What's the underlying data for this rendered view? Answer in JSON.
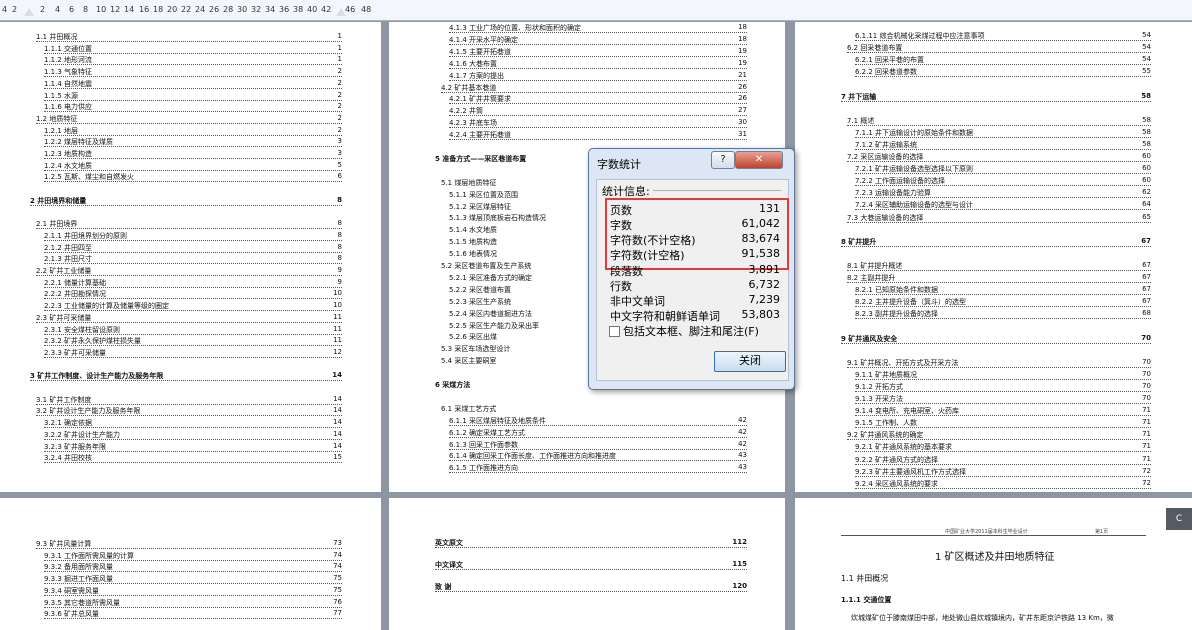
{
  "ruler": {
    "ticks": [
      "4",
      "2",
      "2",
      "4",
      "6",
      "8",
      "10",
      "12",
      "14",
      "16",
      "18",
      "20",
      "22",
      "24",
      "26",
      "28",
      "30",
      "32",
      "34",
      "36",
      "38",
      "40",
      "42",
      "46",
      "48"
    ]
  },
  "pages": {
    "p1": [
      {
        "t": "1.1  井田概况",
        "p": "1",
        "lvl": 1
      },
      {
        "t": "1.1.1  交通位置",
        "p": "1",
        "lvl": 2
      },
      {
        "t": "1.1.2  地形河流",
        "p": "1",
        "lvl": 2
      },
      {
        "t": "1.1.3  气象特征",
        "p": "2",
        "lvl": 2
      },
      {
        "t": "1.1.4  自然地震",
        "p": "2",
        "lvl": 2
      },
      {
        "t": "1.1.5  水源",
        "p": "2",
        "lvl": 2
      },
      {
        "t": "1.1.6  电力供应",
        "p": "2",
        "lvl": 2
      },
      {
        "t": "1.2  地质特征",
        "p": "2",
        "lvl": 1
      },
      {
        "t": "1.2.1  地层",
        "p": "2",
        "lvl": 2
      },
      {
        "t": "1.2.2  煤层特征及煤质",
        "p": "3",
        "lvl": 2
      },
      {
        "t": "1.2.3  地质构造",
        "p": "3",
        "lvl": 2
      },
      {
        "t": "1.2.4  水文地质",
        "p": "5",
        "lvl": 2
      },
      {
        "t": "1.2.5  瓦斯、煤尘和自燃发火",
        "p": "6",
        "lvl": 2
      },
      {
        "t": "",
        "p": "",
        "lvl": 0
      },
      {
        "t": "2  井田境界和储量",
        "p": "8",
        "lvl": 0
      },
      {
        "t": "",
        "p": "",
        "lvl": 0
      },
      {
        "t": "2.1  井田境界",
        "p": "8",
        "lvl": 1
      },
      {
        "t": "2.1.1  井田境界划分的原则",
        "p": "8",
        "lvl": 2
      },
      {
        "t": "2.1.2  井田四至",
        "p": "8",
        "lvl": 2
      },
      {
        "t": "2.1.3  井田尺寸",
        "p": "8",
        "lvl": 2
      },
      {
        "t": "2.2  矿井工业储量",
        "p": "9",
        "lvl": 1
      },
      {
        "t": "2.2.1  储量计算基础",
        "p": "9",
        "lvl": 2
      },
      {
        "t": "2.2.2  井田勘探情况",
        "p": "10",
        "lvl": 2
      },
      {
        "t": "2.2.3  工业储量的计算及储量等级的圈定",
        "p": "10",
        "lvl": 2
      },
      {
        "t": "2.3  矿井可采储量",
        "p": "11",
        "lvl": 1
      },
      {
        "t": "2.3.1  安全煤柱留设原则",
        "p": "11",
        "lvl": 2
      },
      {
        "t": "2.3.2  矿井永久保护煤柱损失量",
        "p": "11",
        "lvl": 2
      },
      {
        "t": "2.3.3  矿井可采储量",
        "p": "12",
        "lvl": 2
      },
      {
        "t": "",
        "p": "",
        "lvl": 0
      },
      {
        "t": "3  矿井工作制度、设计生产能力及服务年限",
        "p": "14",
        "lvl": 0
      },
      {
        "t": "",
        "p": "",
        "lvl": 0
      },
      {
        "t": "3.1  矿井工作制度",
        "p": "14",
        "lvl": 1
      },
      {
        "t": "3.2  矿井设计生产能力及服务年限",
        "p": "14",
        "lvl": 1
      },
      {
        "t": "3.2.1  确定依据",
        "p": "14",
        "lvl": 2
      },
      {
        "t": "3.2.2  矿井设计生产能力",
        "p": "14",
        "lvl": 2
      },
      {
        "t": "3.2.3  矿井服务年限",
        "p": "14",
        "lvl": 2
      },
      {
        "t": "3.2.4  井田校核",
        "p": "15",
        "lvl": 2
      }
    ],
    "p2": [
      {
        "t": "4.1.3  工业广场的位置、形状和面积的确定",
        "p": "18",
        "lvl": 2
      },
      {
        "t": "4.1.4  开采水平的确定",
        "p": "18",
        "lvl": 2
      },
      {
        "t": "4.1.5  主要开拓巷道",
        "p": "19",
        "lvl": 2
      },
      {
        "t": "4.1.6  大巷布置",
        "p": "19",
        "lvl": 2
      },
      {
        "t": "4.1.7  方案的提出",
        "p": "21",
        "lvl": 2
      },
      {
        "t": "4.2  矿井基本巷道",
        "p": "26",
        "lvl": 1
      },
      {
        "t": "4.2.1  矿井井筒要求",
        "p": "26",
        "lvl": 2
      },
      {
        "t": "4.2.2  井筒",
        "p": "27",
        "lvl": 2
      },
      {
        "t": "4.2.3  井底车场",
        "p": "30",
        "lvl": 2
      },
      {
        "t": "4.2.4  主要开拓巷道",
        "p": "31",
        "lvl": 2
      },
      {
        "t": "",
        "p": "",
        "lvl": 0
      },
      {
        "t": "5  准备方式——采区巷道布置",
        "p": "",
        "lvl": 0
      },
      {
        "t": "",
        "p": "",
        "lvl": 0
      },
      {
        "t": "5.1  煤层地质特征",
        "p": "",
        "lvl": 1
      },
      {
        "t": "5.1.1  采区位置及范围",
        "p": "",
        "lvl": 2
      },
      {
        "t": "5.1.2  采区煤层特征",
        "p": "",
        "lvl": 2
      },
      {
        "t": "5.1.3  煤层顶底板岩石构造情况",
        "p": "",
        "lvl": 2
      },
      {
        "t": "5.1.4  水文地质",
        "p": "",
        "lvl": 2
      },
      {
        "t": "5.1.5  地质构造",
        "p": "",
        "lvl": 2
      },
      {
        "t": "5.1.6  地表情况",
        "p": "",
        "lvl": 2
      },
      {
        "t": "5.2  采区巷道布置及生产系统",
        "p": "",
        "lvl": 1
      },
      {
        "t": "5.2.1  采区准备方式的确定",
        "p": "",
        "lvl": 2
      },
      {
        "t": "5.2.2  采区巷道布置",
        "p": "",
        "lvl": 2
      },
      {
        "t": "5.2.3  采区生产系统",
        "p": "",
        "lvl": 2
      },
      {
        "t": "5.2.4  采区内巷道掘进方法",
        "p": "",
        "lvl": 2
      },
      {
        "t": "5.2.5  采区生产能力及采出率",
        "p": "",
        "lvl": 2
      },
      {
        "t": "5.2.6  采区出煤",
        "p": "",
        "lvl": 2
      },
      {
        "t": "5.3  采区车场选型设计",
        "p": "",
        "lvl": 1
      },
      {
        "t": "5.4  采区主要硐室",
        "p": "",
        "lvl": 1
      },
      {
        "t": "",
        "p": "",
        "lvl": 0
      },
      {
        "t": "6  采煤方法",
        "p": "",
        "lvl": 0
      },
      {
        "t": "",
        "p": "",
        "lvl": 0
      },
      {
        "t": "6.1  采煤工艺方式",
        "p": "",
        "lvl": 1
      },
      {
        "t": "6.1.1  采区煤层特征及地质条件",
        "p": "42",
        "lvl": 2
      },
      {
        "t": "6.1.2  确定采煤工艺方式",
        "p": "42",
        "lvl": 2
      },
      {
        "t": "6.1.3  回采工作面参数",
        "p": "42",
        "lvl": 2
      },
      {
        "t": "6.1.4  确定回采工作面长度、工作面推进方向和推进度",
        "p": "43",
        "lvl": 2
      },
      {
        "t": "6.1.5  工作面推进方向",
        "p": "43",
        "lvl": 2
      }
    ],
    "p3": [
      {
        "t": "6.1.11  综合机械化采煤过程中应注意事项",
        "p": "54",
        "lvl": 2
      },
      {
        "t": "6.2  回采巷道布置",
        "p": "54",
        "lvl": 1
      },
      {
        "t": "6.2.1  回采平巷的布置",
        "p": "54",
        "lvl": 2
      },
      {
        "t": "6.2.2  回采巷道参数",
        "p": "55",
        "lvl": 2
      },
      {
        "t": "",
        "p": "",
        "lvl": 0
      },
      {
        "t": "7  井下运输",
        "p": "58",
        "lvl": 0
      },
      {
        "t": "",
        "p": "",
        "lvl": 0
      },
      {
        "t": "7.1  概述",
        "p": "58",
        "lvl": 1
      },
      {
        "t": "7.1.1  井下运输设计的原始条件和数据",
        "p": "58",
        "lvl": 2
      },
      {
        "t": "7.1.2  矿井运输系统",
        "p": "58",
        "lvl": 2
      },
      {
        "t": "7.2  采区运输设备的选择",
        "p": "60",
        "lvl": 1
      },
      {
        "t": "7.2.1  矿井运输设备选型选择以下原则",
        "p": "60",
        "lvl": 2
      },
      {
        "t": "7.2.2  工作面运输设备的选择",
        "p": "60",
        "lvl": 2
      },
      {
        "t": "7.2.3  运输设备能力验算",
        "p": "62",
        "lvl": 2
      },
      {
        "t": "7.2.4  采区辅助运输设备的选型与设计",
        "p": "64",
        "lvl": 2
      },
      {
        "t": "7.3  大巷运输设备的选择",
        "p": "65",
        "lvl": 1
      },
      {
        "t": "",
        "p": "",
        "lvl": 0
      },
      {
        "t": "8  矿井提升",
        "p": "67",
        "lvl": 0
      },
      {
        "t": "",
        "p": "",
        "lvl": 0
      },
      {
        "t": "8.1  矿井提升概述",
        "p": "67",
        "lvl": 1
      },
      {
        "t": "8.2  主副井提升",
        "p": "67",
        "lvl": 1
      },
      {
        "t": "8.2.1  已知原始条件和数据",
        "p": "67",
        "lvl": 2
      },
      {
        "t": "8.2.2  主井提升设备（箕斗）的选型",
        "p": "67",
        "lvl": 2
      },
      {
        "t": "8.2.3  副井提升设备的选择",
        "p": "68",
        "lvl": 2
      },
      {
        "t": "",
        "p": "",
        "lvl": 0
      },
      {
        "t": "9  矿井通风及安全",
        "p": "70",
        "lvl": 0
      },
      {
        "t": "",
        "p": "",
        "lvl": 0
      },
      {
        "t": "9.1  矿井概况、开拓方式及开采方法",
        "p": "70",
        "lvl": 1
      },
      {
        "t": "9.1.1  矿井地质概况",
        "p": "70",
        "lvl": 2
      },
      {
        "t": "9.1.2  开拓方式",
        "p": "70",
        "lvl": 2
      },
      {
        "t": "9.1.3  开采方法",
        "p": "70",
        "lvl": 2
      },
      {
        "t": "9.1.4  变电所、充电硐室、火药库",
        "p": "71",
        "lvl": 2
      },
      {
        "t": "9.1.5  工作制、人数",
        "p": "71",
        "lvl": 2
      },
      {
        "t": "9.2  矿井通风系统的确定",
        "p": "71",
        "lvl": 1
      },
      {
        "t": "9.2.1  矿井通风系统的基本要求",
        "p": "71",
        "lvl": 2
      },
      {
        "t": "9.2.2  矿井通风方式的选择",
        "p": "71",
        "lvl": 2
      },
      {
        "t": "9.2.3  矿井主要通风机工作方式选择",
        "p": "72",
        "lvl": 2
      },
      {
        "t": "9.2.4  采区通风系统的要求",
        "p": "72",
        "lvl": 2
      },
      {
        "t": "9.2.5  工作面通风方式的选择",
        "p": "73",
        "lvl": 2
      }
    ],
    "p4": [
      {
        "t": "9.3  矿井风量计算",
        "p": "73",
        "lvl": 1
      },
      {
        "t": "9.3.1  工作面所需风量的计算",
        "p": "74",
        "lvl": 2
      },
      {
        "t": "9.3.2  备用面所需风量",
        "p": "74",
        "lvl": 2
      },
      {
        "t": "9.3.3  掘进工作面风量",
        "p": "75",
        "lvl": 2
      },
      {
        "t": "9.3.4  硐室需风量",
        "p": "75",
        "lvl": 2
      },
      {
        "t": "9.3.5  其它巷道所需风量",
        "p": "76",
        "lvl": 2
      },
      {
        "t": "9.3.6  矿井总风量",
        "p": "77",
        "lvl": 2
      }
    ],
    "p5": [
      {
        "t": "英文原文",
        "p": "112",
        "lvl": 0
      },
      {
        "t": "",
        "p": "",
        "lvl": 0
      },
      {
        "t": "中文译文",
        "p": "115",
        "lvl": 0
      },
      {
        "t": "",
        "p": "",
        "lvl": 0
      },
      {
        "t": "致    谢",
        "p": "120",
        "lvl": 0
      }
    ],
    "p6": {
      "header_left": "中国矿业大学2011届本科生毕业设计",
      "header_right": "第1页",
      "chapter": "1  矿区概述及井田地质特征",
      "section": "1.1 井田概况",
      "subsection": "1.1.1 交通位置",
      "body": "炊城煤矿位于滕南煤田中部，地处微山县炊城镇境内，矿井东距京沪铁路 13 Km，微"
    }
  },
  "dialog": {
    "title": "字数统计",
    "help_btn": "?",
    "close_x": "✕",
    "stats_label": "统计信息:",
    "rows": [
      {
        "label": "页数",
        "value": "131"
      },
      {
        "label": "字数",
        "value": "61,042"
      },
      {
        "label": "字符数(不计空格)",
        "value": "83,674"
      },
      {
        "label": "字符数(计空格)",
        "value": "91,538"
      },
      {
        "label": "段落数",
        "value": "3,891"
      },
      {
        "label": "行数",
        "value": "6,732"
      },
      {
        "label": "非中文单词",
        "value": "7,239"
      },
      {
        "label": "中文字符和朝鲜语单词",
        "value": "53,803"
      }
    ],
    "checkbox_label": "包括文本框、脚注和尾注(F)",
    "close_button": "关闭"
  },
  "side_tab": "C"
}
